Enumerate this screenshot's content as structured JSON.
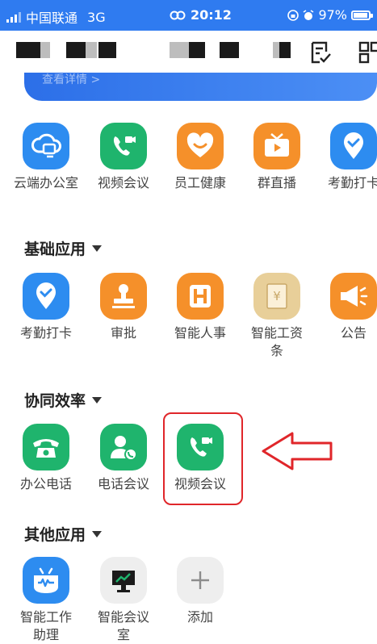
{
  "status_bar": {
    "carrier": "中国联通",
    "network": "3G",
    "time": "20:12",
    "battery": "97%"
  },
  "banner": {
    "link_text": "查看详情 >"
  },
  "top_apps": [
    {
      "label": "云端办公室",
      "icon": "cloud-office-icon",
      "color": "#2d8cf0"
    },
    {
      "label": "视频会议",
      "icon": "video-call-icon",
      "color": "#1fb46d"
    },
    {
      "label": "员工健康",
      "icon": "heart-smile-icon",
      "color": "#f5902a"
    },
    {
      "label": "群直播",
      "icon": "tv-live-icon",
      "color": "#f5902a"
    },
    {
      "label": "考勤打卡",
      "icon": "location-check-icon",
      "color": "#2d8cf0"
    }
  ],
  "sections": [
    {
      "title": "基础应用",
      "apps": [
        {
          "label": "考勤打卡",
          "icon": "location-check-icon",
          "color": "#2d8cf0"
        },
        {
          "label": "审批",
          "icon": "stamp-icon",
          "color": "#f5902a"
        },
        {
          "label": "智能人事",
          "icon": "hr-icon",
          "color": "#f5902a"
        },
        {
          "label": "智能工资条",
          "icon": "salary-icon",
          "color": "#e8cf99"
        },
        {
          "label": "公告",
          "icon": "megaphone-icon",
          "color": "#f5902a"
        }
      ]
    },
    {
      "title": "协同效率",
      "apps": [
        {
          "label": "办公电话",
          "icon": "phone-icon",
          "color": "#1fb46d"
        },
        {
          "label": "电话会议",
          "icon": "conference-call-icon",
          "color": "#1fb46d"
        },
        {
          "label": "视频会议",
          "icon": "video-call-icon",
          "color": "#1fb46d"
        }
      ]
    },
    {
      "title": "其他应用",
      "apps": [
        {
          "label": "智能工作助理",
          "icon": "robot-assistant-icon",
          "color": "#2d8cf0"
        },
        {
          "label": "智能会议室",
          "icon": "presentation-icon",
          "color": "#eeeeee"
        },
        {
          "label": "添加",
          "icon": "plus-icon",
          "color": "#eeeeee"
        }
      ]
    }
  ]
}
